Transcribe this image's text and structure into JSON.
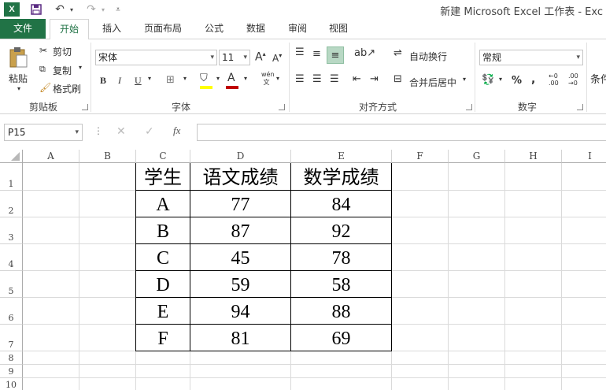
{
  "window": {
    "app_icon": "X",
    "title": "新建 Microsoft Excel 工作表 - Exc"
  },
  "quick_access": {
    "save_icon": "save-icon",
    "undo_icon": "undo-icon",
    "redo_icon": "redo-icon"
  },
  "tabs": [
    "文件",
    "开始",
    "插入",
    "页面布局",
    "公式",
    "数据",
    "审阅",
    "视图"
  ],
  "ribbon": {
    "clipboard": {
      "paste": "粘贴",
      "cut": "剪切",
      "copy": "复制",
      "format_painter": "格式刷",
      "label": "剪贴板"
    },
    "font": {
      "name": "宋体",
      "size": "11",
      "bold": "B",
      "italic": "I",
      "underline": "U",
      "label": "字体",
      "font_color": "#c00000",
      "fill_color": "#ffff00"
    },
    "alignment": {
      "wrap": "自动换行",
      "merge": "合并后居中",
      "label": "对齐方式"
    },
    "number": {
      "format": "常规",
      "percent": "%",
      "comma": ",",
      "label": "数字"
    },
    "styles": {
      "conditional": "条件"
    }
  },
  "formula_bar": {
    "name_box": "P15",
    "fx": "fx",
    "value": ""
  },
  "columns": [
    "A",
    "B",
    "C",
    "D",
    "E",
    "F",
    "G",
    "H",
    "I"
  ],
  "rows": [
    "1",
    "2",
    "3",
    "4",
    "5",
    "6",
    "7",
    "8",
    "9",
    "10"
  ],
  "table": {
    "headers": [
      "学生",
      "语文成绩",
      "数学成绩"
    ],
    "rows": [
      [
        "A",
        "77",
        "84"
      ],
      [
        "B",
        "87",
        "92"
      ],
      [
        "C",
        "45",
        "78"
      ],
      [
        "D",
        "59",
        "58"
      ],
      [
        "E",
        "94",
        "88"
      ],
      [
        "F",
        "81",
        "69"
      ]
    ]
  }
}
